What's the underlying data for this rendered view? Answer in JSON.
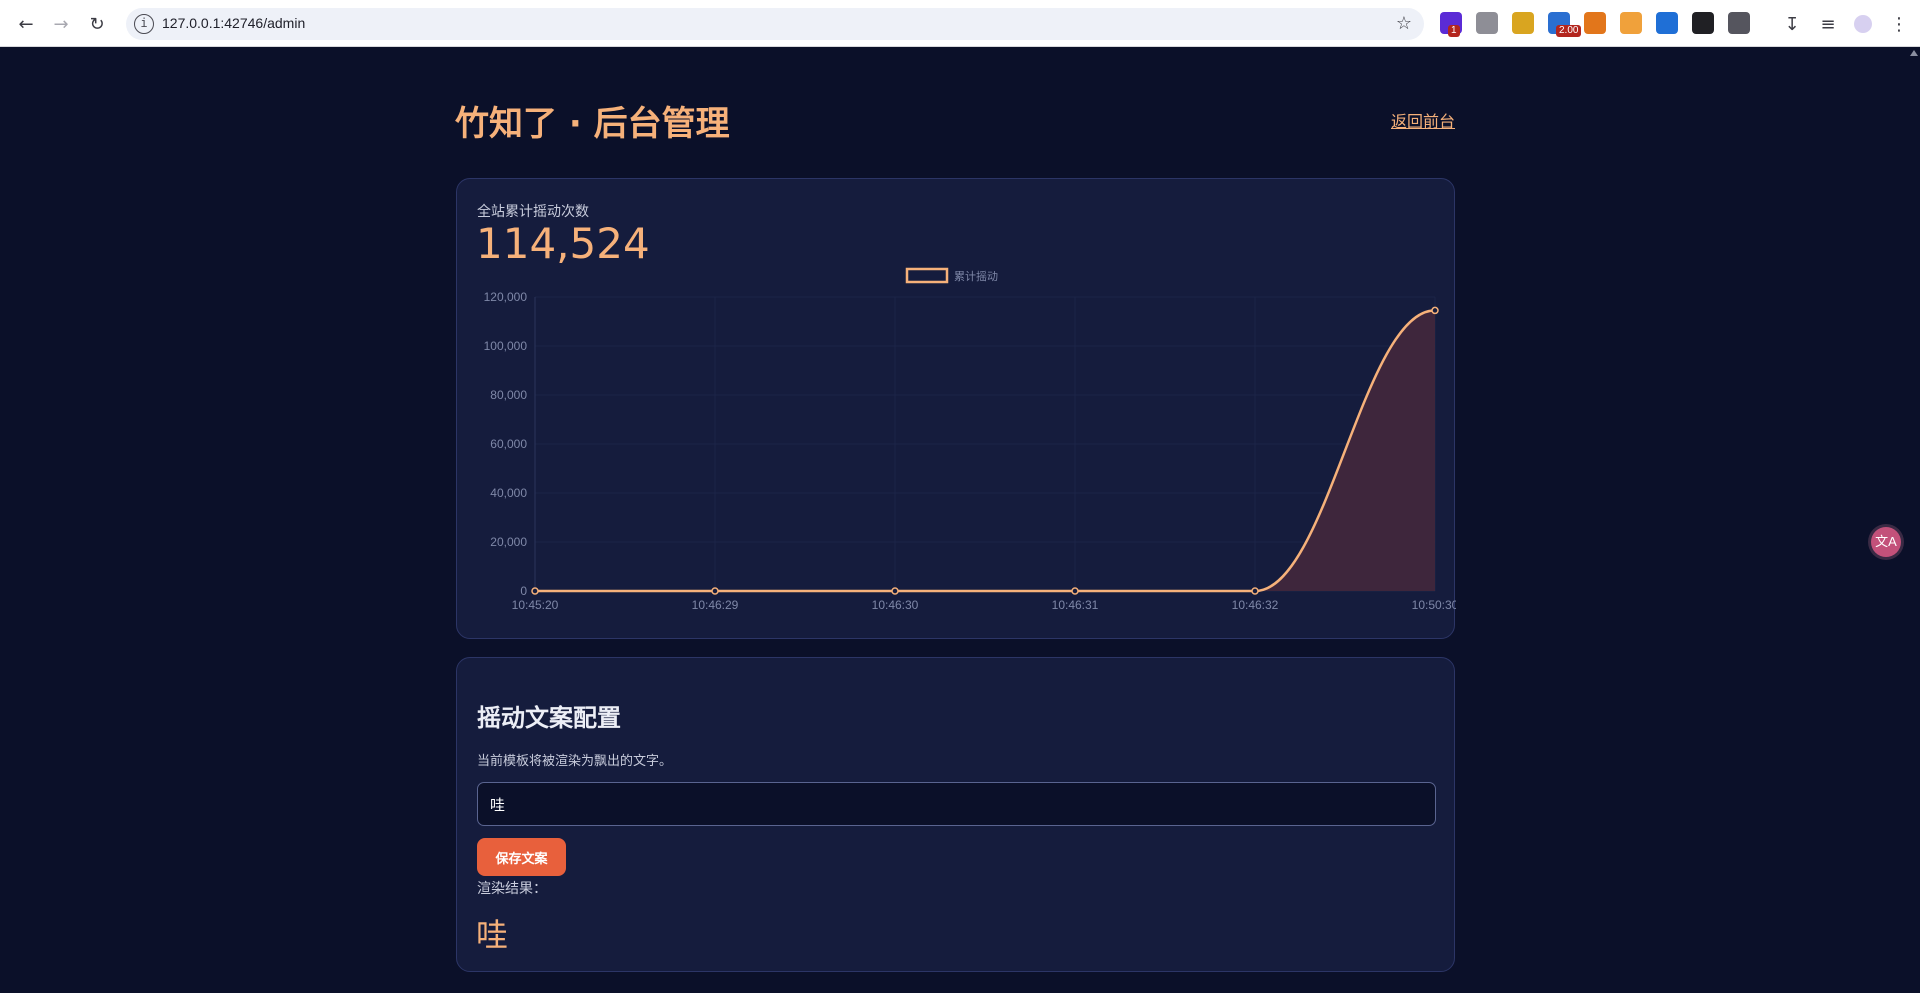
{
  "browser": {
    "url": "127.0.0.1:42746/admin",
    "extensions": [
      {
        "name": "extension-1-icon",
        "badge": "1",
        "color": "#5b2bd6"
      },
      {
        "name": "extension-vue-icon",
        "badge": "",
        "color": "#8e8e96"
      },
      {
        "name": "extension-cat-icon",
        "badge": "",
        "color": "#d9a520"
      },
      {
        "name": "extension-video-speed-icon",
        "badge": "2.00",
        "color": "#2a6fd1"
      },
      {
        "name": "extension-metamask-icon",
        "badge": "",
        "color": "#e2761b"
      },
      {
        "name": "extension-orange-icon",
        "badge": "",
        "color": "#f0a13b"
      },
      {
        "name": "extension-z-icon",
        "badge": "",
        "color": "#1f6fd6"
      },
      {
        "name": "extension-face-icon",
        "badge": "",
        "color": "#202024"
      },
      {
        "name": "extension-puzzle-icon",
        "badge": "",
        "color": "#55555e"
      }
    ]
  },
  "header": {
    "title": "竹知了 · 后台管理",
    "back_link": "返回前台"
  },
  "stats": {
    "label": "全站累计摇动次数",
    "total": "114,524"
  },
  "chart_data": {
    "type": "area",
    "title": "",
    "series": [
      {
        "name": "累计摇动",
        "values": [
          0,
          0,
          0,
          0,
          0,
          114524
        ],
        "color": "#f6b17a",
        "fill": "#43283c"
      }
    ],
    "x": [
      "10:45:20",
      "10:46:29",
      "10:46:30",
      "10:46:31",
      "10:46:32",
      "10:50:30"
    ],
    "y_ticks": [
      "0",
      "20,000",
      "40,000",
      "60,000",
      "80,000",
      "100,000",
      "120,000"
    ],
    "ylim": [
      0,
      120000
    ],
    "legend_position": "top-center",
    "grid": true
  },
  "config": {
    "title": "摇动文案配置",
    "description": "当前模板将被渲染为飘出的文字。",
    "template_value": "哇",
    "save_label": "保存文案",
    "result_label": "渲染结果：",
    "result_value": "哇"
  },
  "colors": {
    "accent": "#f6b17a",
    "button": "#e8603c",
    "background": "#0b1029",
    "card": "#151c3d"
  }
}
